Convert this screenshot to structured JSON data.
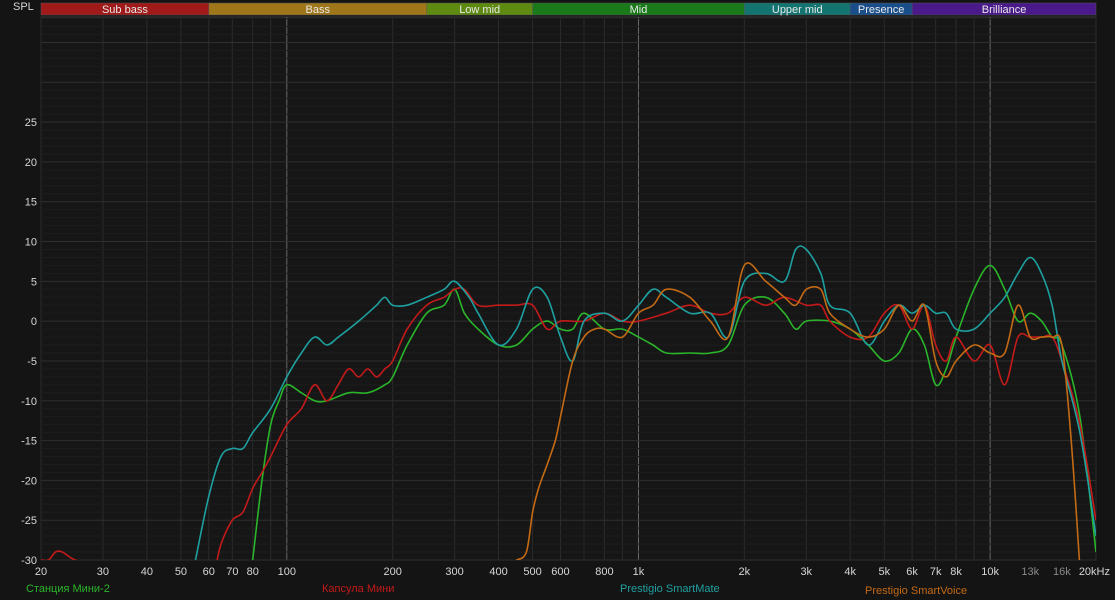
{
  "chart_data": {
    "type": "line",
    "ylabel": "SPL",
    "xscale": "log",
    "xlim": [
      20,
      20000
    ],
    "ylim": [
      -30,
      30
    ],
    "grid": true,
    "bands": [
      {
        "name": "Sub bass",
        "from": 20,
        "to": 60,
        "color": "#a01a1a"
      },
      {
        "name": "Bass",
        "from": 60,
        "to": 250,
        "color": "#a0761a"
      },
      {
        "name": "Low mid",
        "from": 250,
        "to": 500,
        "color": "#5e8a12"
      },
      {
        "name": "Mid",
        "from": 500,
        "to": 2000,
        "color": "#1a7a1a"
      },
      {
        "name": "Upper mid",
        "from": 2000,
        "to": 4000,
        "color": "#137470"
      },
      {
        "name": "Presence",
        "from": 4000,
        "to": 6000,
        "color": "#1a4e8a"
      },
      {
        "name": "Brilliance",
        "from": 6000,
        "to": 20000,
        "color": "#4a1a8a"
      }
    ],
    "x_ticks": [
      {
        "v": 20,
        "label": "20"
      },
      {
        "v": 30,
        "label": "30"
      },
      {
        "v": 40,
        "label": "40"
      },
      {
        "v": 50,
        "label": "50"
      },
      {
        "v": 60,
        "label": "60"
      },
      {
        "v": 70,
        "label": "70"
      },
      {
        "v": 80,
        "label": "80"
      },
      {
        "v": 100,
        "label": "100"
      },
      {
        "v": 200,
        "label": "200"
      },
      {
        "v": 300,
        "label": "300"
      },
      {
        "v": 400,
        "label": "400"
      },
      {
        "v": 500,
        "label": "500"
      },
      {
        "v": 600,
        "label": "600"
      },
      {
        "v": 800,
        "label": "800"
      },
      {
        "v": 1000,
        "label": "1k"
      },
      {
        "v": 2000,
        "label": "2k"
      },
      {
        "v": 3000,
        "label": "3k"
      },
      {
        "v": 4000,
        "label": "4k"
      },
      {
        "v": 5000,
        "label": "5k"
      },
      {
        "v": 6000,
        "label": "6k"
      },
      {
        "v": 7000,
        "label": "7k"
      },
      {
        "v": 8000,
        "label": "8k"
      },
      {
        "v": 10000,
        "label": "10k"
      },
      {
        "v": 13000,
        "label": "13k",
        "dim": true
      },
      {
        "v": 16000,
        "label": "16k",
        "dim": true
      },
      {
        "v": 20000,
        "label": "20kHz"
      }
    ],
    "y_ticks": [
      25,
      20,
      15,
      10,
      5,
      0,
      -5,
      -10,
      -15,
      -20,
      -25,
      -30
    ],
    "series": [
      {
        "name": "Станция Мини-2",
        "color": "#2ab52a",
        "x": [
          80,
          85,
          90,
          95,
          100,
          110,
          120,
          130,
          150,
          170,
          190,
          200,
          220,
          250,
          280,
          300,
          320,
          350,
          400,
          450,
          500,
          550,
          600,
          650,
          700,
          800,
          900,
          1000,
          1100,
          1200,
          1400,
          1600,
          1800,
          2000,
          2300,
          2600,
          2800,
          3000,
          3500,
          4000,
          4500,
          5000,
          5500,
          6000,
          6500,
          7000,
          7500,
          8000,
          9000,
          10000,
          11000,
          12000,
          13000,
          14000,
          15000,
          16000,
          18000,
          20000
        ],
        "y": [
          -30,
          -20,
          -13,
          -10,
          -8,
          -9,
          -10,
          -10,
          -9,
          -9,
          -8,
          -7,
          -3,
          1,
          2,
          4,
          1,
          -1,
          -3,
          -3,
          -1,
          0,
          -1,
          -1,
          1,
          -1,
          -1,
          -2,
          -3,
          -4,
          -4,
          -4,
          -3,
          2,
          3,
          1,
          -1,
          0,
          0,
          -1,
          -3,
          -5,
          -4,
          -1,
          -3,
          -8,
          -6,
          -2,
          4,
          7,
          4,
          0,
          1,
          0,
          -2,
          -3,
          -12,
          -29
        ]
      },
      {
        "name": "Капсула Мини",
        "color": "#c41a1a",
        "x": [
          20,
          21,
          22,
          23,
          25,
          30,
          40,
          50,
          60,
          65,
          70,
          75,
          80,
          85,
          90,
          100,
          110,
          120,
          130,
          140,
          150,
          160,
          170,
          180,
          190,
          200,
          220,
          250,
          280,
          300,
          320,
          350,
          400,
          450,
          500,
          550,
          600,
          700,
          800,
          900,
          1000,
          1200,
          1400,
          1600,
          1800,
          2000,
          2300,
          2600,
          3000,
          3300,
          3500,
          4000,
          4500,
          5000,
          5500,
          6000,
          6500,
          7000,
          7500,
          8000,
          9000,
          10000,
          11000,
          12000,
          13000,
          14000,
          15000,
          16000,
          18000,
          20000
        ],
        "y": [
          -30,
          -30,
          -29,
          -29,
          -30,
          -31,
          -32,
          -33,
          -33,
          -28,
          -25,
          -24,
          -21,
          -19,
          -17,
          -13,
          -11,
          -8,
          -10,
          -8,
          -6,
          -7,
          -6,
          -7,
          -6,
          -5,
          -1,
          2,
          3,
          4,
          4,
          2,
          2,
          2,
          2,
          -1,
          0,
          0,
          1,
          0,
          0,
          1,
          2,
          1,
          1,
          3,
          2,
          3,
          2,
          2,
          0,
          -2,
          -2,
          1,
          2,
          -1,
          2,
          -3,
          -5,
          -2,
          -5,
          -3,
          -8,
          -2,
          -2,
          -2,
          -2,
          -5,
          -13,
          -25
        ]
      },
      {
        "name": "Prestigio SmartMate",
        "color": "#1fa0a0",
        "x": [
          55,
          60,
          65,
          70,
          75,
          80,
          90,
          100,
          110,
          120,
          130,
          140,
          150,
          160,
          170,
          180,
          190,
          200,
          220,
          250,
          280,
          300,
          330,
          350,
          400,
          450,
          500,
          550,
          600,
          650,
          700,
          800,
          900,
          1000,
          1100,
          1200,
          1400,
          1600,
          1800,
          2000,
          2300,
          2600,
          2800,
          3000,
          3300,
          3500,
          4000,
          4500,
          5000,
          5500,
          6000,
          6500,
          7000,
          7500,
          8000,
          9000,
          10000,
          11000,
          12000,
          13000,
          14000,
          15000,
          16000,
          18000,
          20000
        ],
        "y": [
          -30,
          -22,
          -17,
          -16,
          -16,
          -14,
          -11,
          -7,
          -4,
          -2,
          -3,
          -2,
          -1,
          0,
          1,
          2,
          3,
          2,
          2,
          3,
          4,
          5,
          3,
          1,
          -3,
          -1,
          4,
          3,
          -2,
          -5,
          0,
          1,
          0,
          2,
          4,
          3,
          1,
          1,
          -2,
          5,
          6,
          5,
          9,
          9,
          6,
          2,
          1,
          -3,
          0,
          2,
          1,
          2,
          1,
          1,
          -1,
          -1,
          1,
          3,
          6,
          8,
          6,
          2,
          -5,
          -14,
          -27
        ]
      },
      {
        "name": "Prestigio SmartVoice",
        "color": "#c46a14",
        "x": [
          450,
          480,
          500,
          520,
          550,
          580,
          600,
          650,
          700,
          750,
          800,
          900,
          1000,
          1100,
          1200,
          1400,
          1600,
          1800,
          2000,
          2300,
          2600,
          2800,
          3000,
          3300,
          3500,
          4000,
          4500,
          5000,
          5500,
          6000,
          6500,
          7000,
          7500,
          8000,
          9000,
          10000,
          11000,
          12000,
          13000,
          14000,
          15000,
          16000,
          17000,
          18000
        ],
        "y": [
          -30,
          -29,
          -24,
          -21,
          -18,
          -15,
          -12,
          -5,
          -2,
          -1,
          -1,
          -2,
          1,
          2,
          4,
          3,
          0,
          -2,
          7,
          5,
          3,
          2,
          4,
          4,
          1,
          -1,
          -2,
          -1,
          2,
          0,
          2,
          -5,
          -7,
          -5,
          -3,
          -4,
          -4,
          2,
          -2,
          -2,
          -2,
          -3,
          -15,
          -31
        ]
      }
    ]
  }
}
